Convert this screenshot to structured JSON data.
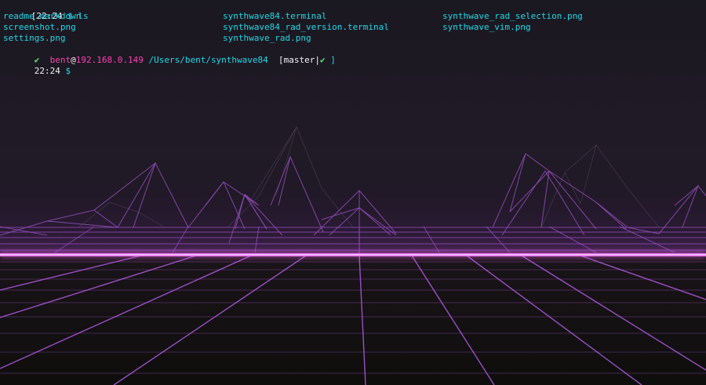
{
  "terminal": {
    "prompt1": {
      "bracket_open": "[",
      "time": "22:24",
      "dollar": "$",
      "command": "ls"
    },
    "listing": {
      "col1": [
        "readme.markdown",
        "screenshot.png",
        "settings.png"
      ],
      "col2": [
        "synthwave84.terminal",
        "synthwave84_rad_version.terminal",
        "synthwave_rad.png"
      ],
      "col3": [
        "synthwave_rad_selection.png",
        "synthwave_vim.png"
      ]
    },
    "status": {
      "check": "✔",
      "user": "bent",
      "at": "@",
      "host": "192.168.0.149",
      "path": "/Users/bent/synthwave84",
      "branch_open": "[",
      "branch": "master",
      "branch_sep": "|",
      "branch_check": "✔",
      "branch_close": " ]"
    },
    "prompt2": {
      "time": "22:24",
      "dollar": "$"
    }
  },
  "colors": {
    "file_text": "#20d8e8",
    "user_host": "#ff3fb4",
    "path": "#20d8e8",
    "check": "#57f27a",
    "grid": "#a34fd6",
    "horizon": "#ff7bff"
  }
}
